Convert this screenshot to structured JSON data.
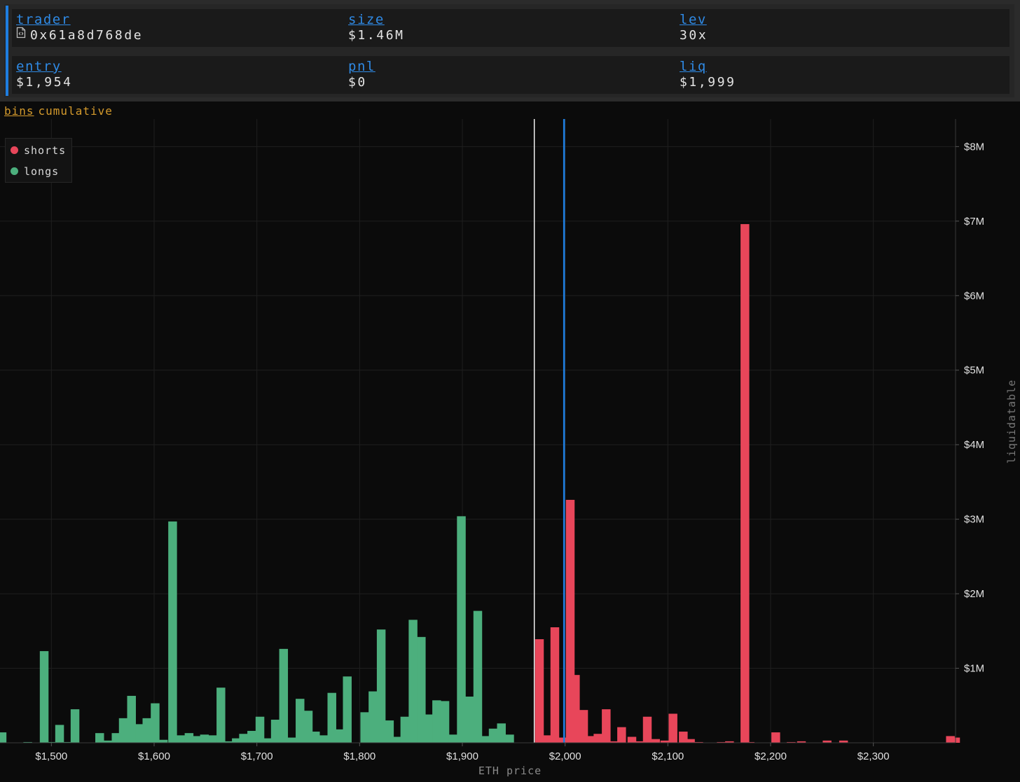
{
  "position": {
    "fields": [
      {
        "label": "trader",
        "value": "0x61a8d768de",
        "icon": "file-code-icon"
      },
      {
        "label": "size",
        "value": "$1.46M"
      },
      {
        "label": "lev",
        "value": "30x"
      },
      {
        "label": "entry",
        "value": "$1,954"
      },
      {
        "label": "pnl",
        "value": "$0"
      },
      {
        "label": "liq",
        "value": "$1,999"
      }
    ],
    "accent_color": "#1e7ee0"
  },
  "modes": {
    "bins": "bins",
    "cumulative": "cumulative",
    "active": "bins"
  },
  "chart_data": {
    "type": "bar",
    "title": "",
    "xlabel": "ETH price",
    "ylabel": "liquidatable",
    "xlim": [
      1450,
      2380
    ],
    "ylim": [
      0,
      8370000
    ],
    "x_ticks": [
      1500,
      1600,
      1700,
      1800,
      1900,
      2000,
      2100,
      2200,
      2300
    ],
    "x_tick_labels": [
      "$1,500",
      "$1,600",
      "$1,700",
      "$1,800",
      "$1,900",
      "$2,000",
      "$2,100",
      "$2,200",
      "$2,300"
    ],
    "y_ticks": [
      1000000,
      2000000,
      3000000,
      4000000,
      5000000,
      6000000,
      7000000,
      8000000
    ],
    "y_tick_labels": [
      "$1M",
      "$2M",
      "$3M",
      "$4M",
      "$5M",
      "$6M",
      "$7M",
      "$8M"
    ],
    "y_axis_position": "right",
    "grid": true,
    "legend_position": "top-left",
    "bin_width": 5,
    "markers": [
      {
        "name": "current price",
        "x": 1970,
        "color": "#ffffff"
      },
      {
        "name": "liq",
        "x": 1999,
        "color": "#1e7ee0"
      }
    ],
    "series": [
      {
        "name": "shorts",
        "color": "#e8465a",
        "x": [
          1975,
          1982,
          1990,
          1998,
          2005,
          2010,
          2018,
          2025,
          2032,
          2040,
          2047,
          2055,
          2065,
          2072,
          2080,
          2088,
          2097,
          2105,
          2115,
          2122,
          2130,
          2152,
          2160,
          2175,
          2180,
          2205,
          2220,
          2230,
          2255,
          2271,
          2375,
          2380
        ],
        "values": [
          1390000,
          100000,
          1550000,
          70000,
          3260000,
          910000,
          440000,
          90000,
          120000,
          450000,
          20000,
          210000,
          80000,
          20000,
          350000,
          50000,
          30000,
          390000,
          150000,
          50000,
          10000,
          10000,
          20000,
          6960000,
          10000,
          140000,
          10000,
          20000,
          30000,
          30000,
          90000,
          70000
        ]
      },
      {
        "name": "longs",
        "color": "#4caf7d",
        "x": [
          1452,
          1477,
          1493,
          1500,
          1508,
          1515,
          1523,
          1547,
          1555,
          1563,
          1570,
          1578,
          1586,
          1593,
          1601,
          1609,
          1618,
          1626,
          1634,
          1641,
          1649,
          1657,
          1665,
          1673,
          1680,
          1687,
          1695,
          1703,
          1711,
          1718,
          1726,
          1734,
          1742,
          1750,
          1757,
          1765,
          1773,
          1780,
          1788,
          1805,
          1813,
          1821,
          1829,
          1836,
          1844,
          1852,
          1860,
          1867,
          1875,
          1883,
          1891,
          1899,
          1907,
          1915,
          1923,
          1930,
          1938,
          1946
        ],
        "values": [
          140000,
          10000,
          1230000,
          10000,
          240000,
          10000,
          450000,
          130000,
          30000,
          130000,
          330000,
          630000,
          250000,
          330000,
          530000,
          40000,
          2970000,
          100000,
          130000,
          90000,
          110000,
          100000,
          740000,
          20000,
          60000,
          120000,
          160000,
          350000,
          60000,
          310000,
          1260000,
          70000,
          590000,
          430000,
          150000,
          100000,
          670000,
          180000,
          890000,
          410000,
          690000,
          1520000,
          300000,
          80000,
          350000,
          1650000,
          1420000,
          380000,
          570000,
          560000,
          110000,
          3040000,
          620000,
          1770000,
          90000,
          190000,
          260000,
          110000
        ]
      }
    ]
  }
}
